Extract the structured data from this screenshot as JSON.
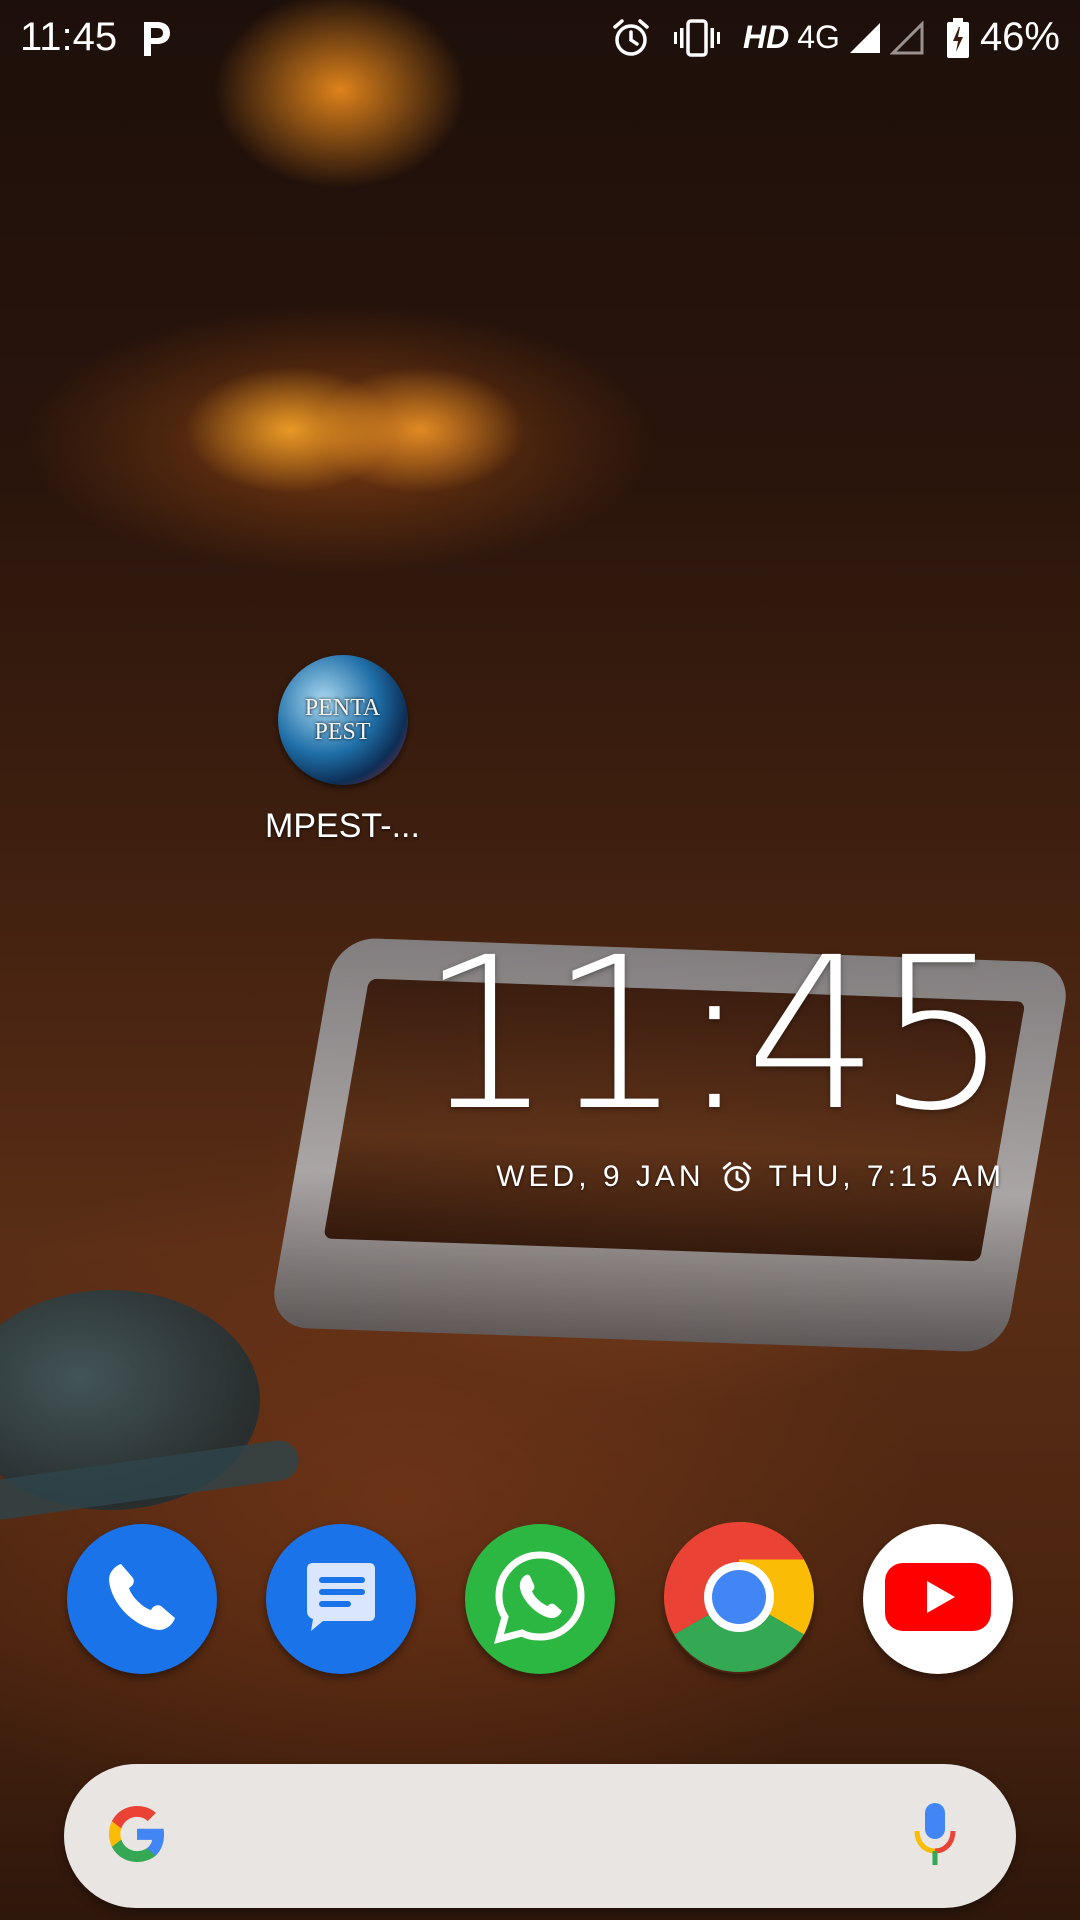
{
  "status_bar": {
    "time": "11:45",
    "notification_icon": "p-icon",
    "icons": [
      "alarm-icon",
      "vibrate-icon",
      "signal-icon",
      "signal-empty-icon",
      "battery-icon"
    ],
    "hd_label": "HD",
    "network_label": "4G",
    "battery_percent": "46%"
  },
  "home": {
    "app_shortcut": {
      "logo_line1": "PENTA",
      "logo_line2": "PEST",
      "label": "MPEST-..."
    },
    "clock_widget": {
      "time": "11:45",
      "date": "WED, 9 JAN",
      "alarm_icon": "alarm-icon",
      "next_alarm": "THU, 7:15 AM"
    },
    "dock": [
      {
        "name": "phone",
        "icon": "phone-icon",
        "color": "#1a73e8"
      },
      {
        "name": "messages",
        "icon": "messages-icon",
        "color": "#1a73e8"
      },
      {
        "name": "whatsapp",
        "icon": "whatsapp-icon",
        "color": "#2bb741"
      },
      {
        "name": "chrome",
        "icon": "chrome-icon",
        "color": "#4285f4"
      },
      {
        "name": "youtube",
        "icon": "youtube-icon",
        "color": "#ff0000"
      }
    ],
    "search_bar": {
      "left_icon": "google-g-icon",
      "right_icon": "microphone-icon"
    }
  },
  "colors": {
    "google_blue": "#4285f4",
    "google_red": "#ea4335",
    "google_yellow": "#fbbc05",
    "google_green": "#34a853"
  }
}
